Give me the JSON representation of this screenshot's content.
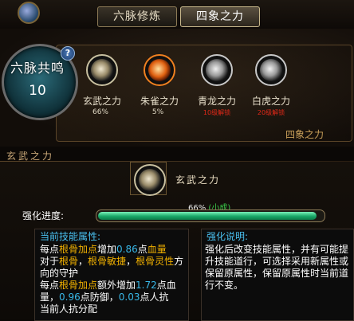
{
  "tabs": [
    {
      "label": "六脉修炼",
      "active": false
    },
    {
      "label": "四象之力",
      "active": true
    }
  ],
  "core": {
    "title": "六脉共鸣",
    "level": "10",
    "help": "?"
  },
  "powers": [
    {
      "name": "玄武之力",
      "pct": "66%",
      "locked": "",
      "icon": "turtle-icon",
      "ring": "#c8c0a0"
    },
    {
      "name": "朱雀之力",
      "pct": "5%",
      "locked": "",
      "icon": "phoenix-icon",
      "ring": "#f08020"
    },
    {
      "name": "青龙之力",
      "pct": "",
      "locked": "10级解锁",
      "icon": "dragon-icon",
      "ring": "#c8c8c8"
    },
    {
      "name": "白虎之力",
      "pct": "",
      "locked": "20级解锁",
      "icon": "tiger-icon",
      "ring": "#c8c8c8"
    }
  ],
  "panel_seal": "四象之力",
  "section_title": "玄武之力",
  "detail": {
    "name": "玄武之力",
    "progress_label": "强化进度:",
    "progress_pct_text": "66%",
    "progress_level": "(小成)",
    "progress": 0.98
  },
  "current_attr": {
    "heading": "当前技能属性:",
    "p1_prefix": "每点",
    "p1_g1": "根骨加点",
    "p1_mid1": "增加",
    "p1_c1": "0.86",
    "p1_mid2": "点",
    "p1_g2": "血量",
    "p2_prefix": "对于",
    "p2_g1": "根骨",
    "p2_sep1": "，",
    "p2_g2": "根骨敏捷",
    "p2_sep2": "，",
    "p2_g3": "根骨灵性",
    "p2_suffix": "方向的守护",
    "p3_prefix": "每点",
    "p3_g1": "根骨加点",
    "p3_mid1": "额外增加",
    "p3_c1": "1.72",
    "p3_mid2": "点血量，",
    "p3_c2": "0.96",
    "p3_mid3": "点防御，",
    "p3_c3": "0.03",
    "p3_mid4": "点人抗",
    "p4": "当前人抗分配"
  },
  "explain": {
    "heading": "强化说明:",
    "text": "强化后改变技能属性，并有可能提升技能道行，可选择采用新属性或保留原属性，保留原属性时当前道行不变。"
  }
}
